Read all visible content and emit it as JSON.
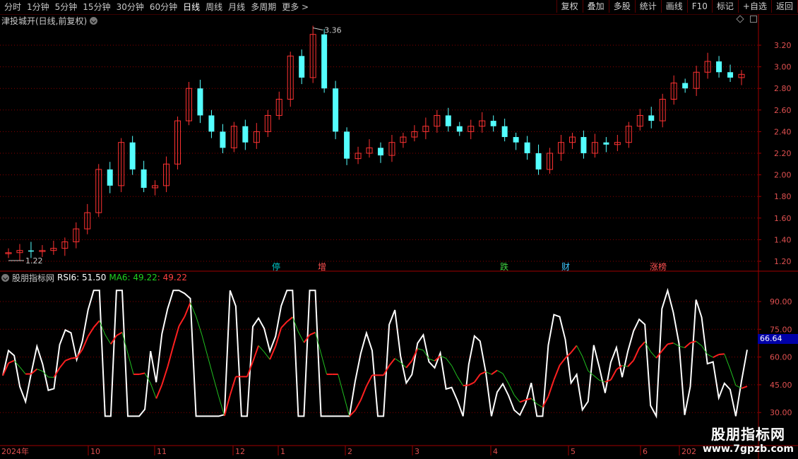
{
  "toolbar": {
    "periods": [
      "分时",
      "1分钟",
      "5分钟",
      "15分钟",
      "30分钟",
      "60分钟",
      "日线",
      "周线",
      "月线",
      "多周期",
      "更多 >"
    ],
    "active_period": "日线",
    "buttons": [
      "复权",
      "叠加",
      "多股",
      "统计",
      "画线",
      "F10",
      "标记",
      "+自选",
      "返回"
    ]
  },
  "main_chart": {
    "title": "津投城开(日线,前复权)",
    "high_label": "3.36",
    "low_label": "1.22",
    "y_ticks": [
      "3.20",
      "3.00",
      "2.80",
      "2.60",
      "2.40",
      "2.20",
      "2.00",
      "1.80",
      "1.60",
      "1.40",
      "1.20"
    ],
    "event_tags": [
      {
        "text": "停",
        "color": "#00c8c8"
      },
      {
        "text": "增",
        "color": "#ff5050"
      },
      {
        "text": "跌",
        "color": "#40d040"
      },
      {
        "text": "财",
        "color": "#40c8ff"
      },
      {
        "text": "涨榜",
        "color": "#ff5050"
      }
    ]
  },
  "sub_chart": {
    "name": "股朋指标网",
    "rsi_label": "RSI6: 51.50",
    "ma_label": "MA6: 49.22",
    "ma_value2": ": 49.22",
    "y_ticks": [
      "90.00",
      "75.00",
      "60.00",
      "45.00",
      "30.00"
    ],
    "cursor_value": "66.64"
  },
  "x_axis": {
    "labels": [
      "2024年",
      "10",
      "11",
      "12",
      "1",
      "2",
      "3",
      "4",
      "5",
      "6",
      "202"
    ]
  },
  "watermark": {
    "line1": "股朋指标网",
    "line2": "www.7gpzb.com"
  },
  "colors": {
    "up": "#ff3232",
    "down": "#54ffff",
    "rsi": "#ffffff",
    "ma_up": "#ff2020",
    "ma_down": "#20c020",
    "grid": "#8a0000",
    "axis_text": "#e05050"
  },
  "chart_data": [
    {
      "type": "candlestick",
      "title": "津投城开(日线,前复权)",
      "ylim": [
        1.15,
        3.4
      ],
      "x_labels": [
        "2024年",
        "10",
        "11",
        "12",
        "1",
        "2",
        "3",
        "4",
        "5",
        "6"
      ],
      "close_approx": [
        1.28,
        1.3,
        1.29,
        1.3,
        1.32,
        1.38,
        1.5,
        1.65,
        2.05,
        1.9,
        2.3,
        2.05,
        1.88,
        1.9,
        2.1,
        2.5,
        2.8,
        2.55,
        2.4,
        2.25,
        2.45,
        2.3,
        2.4,
        2.55,
        2.7,
        3.1,
        2.9,
        3.3,
        2.8,
        2.4,
        2.15,
        2.2,
        2.25,
        2.18,
        2.3,
        2.35,
        2.4,
        2.45,
        2.55,
        2.45,
        2.4,
        2.45,
        2.5,
        2.45,
        2.35,
        2.3,
        2.2,
        2.05,
        2.2,
        2.3,
        2.35,
        2.2,
        2.3,
        2.28,
        2.3,
        2.45,
        2.55,
        2.5,
        2.7,
        2.85,
        2.8,
        2.95,
        3.05,
        2.95,
        2.9,
        2.93
      ]
    },
    {
      "type": "line",
      "title": "RSI6",
      "ylim": [
        25,
        100
      ],
      "series": [
        {
          "name": "RSI6",
          "last": 51.5
        },
        {
          "name": "MA6",
          "last": 49.22
        }
      ]
    }
  ]
}
